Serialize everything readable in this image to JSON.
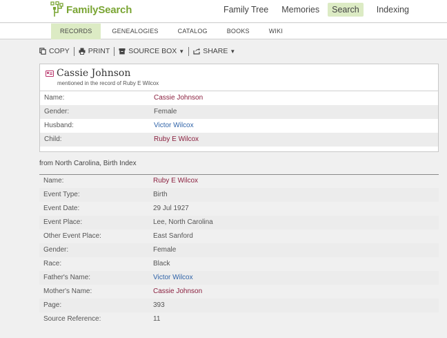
{
  "brand": {
    "name": "FamilySearch"
  },
  "main_nav": [
    {
      "label": "Family Tree",
      "active": false
    },
    {
      "label": "Memories",
      "active": false
    },
    {
      "label": "Search",
      "active": true
    },
    {
      "label": "Indexing",
      "active": false
    }
  ],
  "sub_nav": [
    {
      "label": "RECORDS",
      "active": true
    },
    {
      "label": "GENEALOGIES",
      "active": false
    },
    {
      "label": "CATALOG",
      "active": false
    },
    {
      "label": "BOOKS",
      "active": false
    },
    {
      "label": "WIKI",
      "active": false
    }
  ],
  "toolbar": {
    "copy": "COPY",
    "print": "PRINT",
    "source_box": "SOURCE BOX",
    "share": "SHARE"
  },
  "person": {
    "name": "Cassie Johnson",
    "mentioned": "mentioned in the record of Ruby E Wilcox",
    "fields": [
      {
        "label": "Name:",
        "value": "Cassie Johnson",
        "style": "red"
      },
      {
        "label": "Gender:",
        "value": "Female",
        "style": "plain"
      },
      {
        "label": "Husband:",
        "value": "Victor Wilcox",
        "style": "blue"
      },
      {
        "label": "Child:",
        "value": "Ruby E Wilcox",
        "style": "red"
      }
    ]
  },
  "source": "from North Carolina, Birth Index",
  "record": [
    {
      "label": "Name:",
      "value": "Ruby E Wilcox",
      "style": "red"
    },
    {
      "label": "Event Type:",
      "value": "Birth",
      "style": "plain"
    },
    {
      "label": "Event Date:",
      "value": "29 Jul 1927",
      "style": "plain"
    },
    {
      "label": "Event Place:",
      "value": "Lee, North Carolina",
      "style": "plain"
    },
    {
      "label": "Other Event Place:",
      "value": "East Sanford",
      "style": "plain"
    },
    {
      "label": "Gender:",
      "value": "Female",
      "style": "plain"
    },
    {
      "label": "Race:",
      "value": "Black",
      "style": "plain"
    },
    {
      "label": "Father's Name:",
      "value": "Victor Wilcox",
      "style": "blue"
    },
    {
      "label": "Mother's Name:",
      "value": "Cassie Johnson",
      "style": "red"
    },
    {
      "label": "Page:",
      "value": "393",
      "style": "plain"
    },
    {
      "label": "Source Reference:",
      "value": "11",
      "style": "plain"
    }
  ],
  "colors": {
    "brand_green": "#7aa534",
    "active_bg": "#dcebc4",
    "person_link": "#8a1f3e",
    "relative_link": "#2f63a8"
  }
}
